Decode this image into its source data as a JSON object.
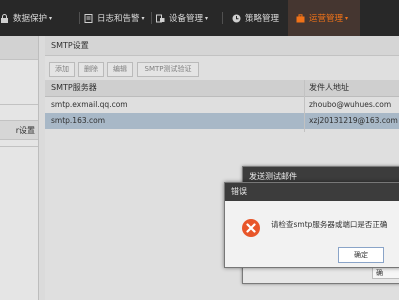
{
  "nav": {
    "items": [
      {
        "label": "数据保护",
        "caret": "▾"
      },
      {
        "label": "日志和告警",
        "caret": "▾"
      },
      {
        "label": "设备管理",
        "caret": "▾"
      },
      {
        "label": "策略管理",
        "caret": ""
      },
      {
        "label": "运营管理",
        "caret": "▾"
      }
    ],
    "active_color": "#ff7a1a"
  },
  "sidebar": {
    "partial_item_label": "r设置"
  },
  "panel": {
    "title": "SMTP设置"
  },
  "toolbar": {
    "add_label": "添加",
    "delete_label": "删除",
    "edit_label": "编辑",
    "test_label": "SMTP测试验证"
  },
  "table": {
    "columns": [
      "SMTP服务器",
      "发件人地址"
    ],
    "rows": [
      {
        "server": "smtp.exmail.qq.com",
        "sender": "zhoubo@wuhues.com"
      },
      {
        "server": "smtp.163.com",
        "sender": "xzj20131219@163.com"
      }
    ]
  },
  "dialog_test": {
    "title": "发送测试邮件",
    "partial_button": "确"
  },
  "dialog_error": {
    "title": "错误",
    "message": "请检查smtp服务器或端口是否正确",
    "ok_label": "确定",
    "icon_color": "#e8562a"
  }
}
